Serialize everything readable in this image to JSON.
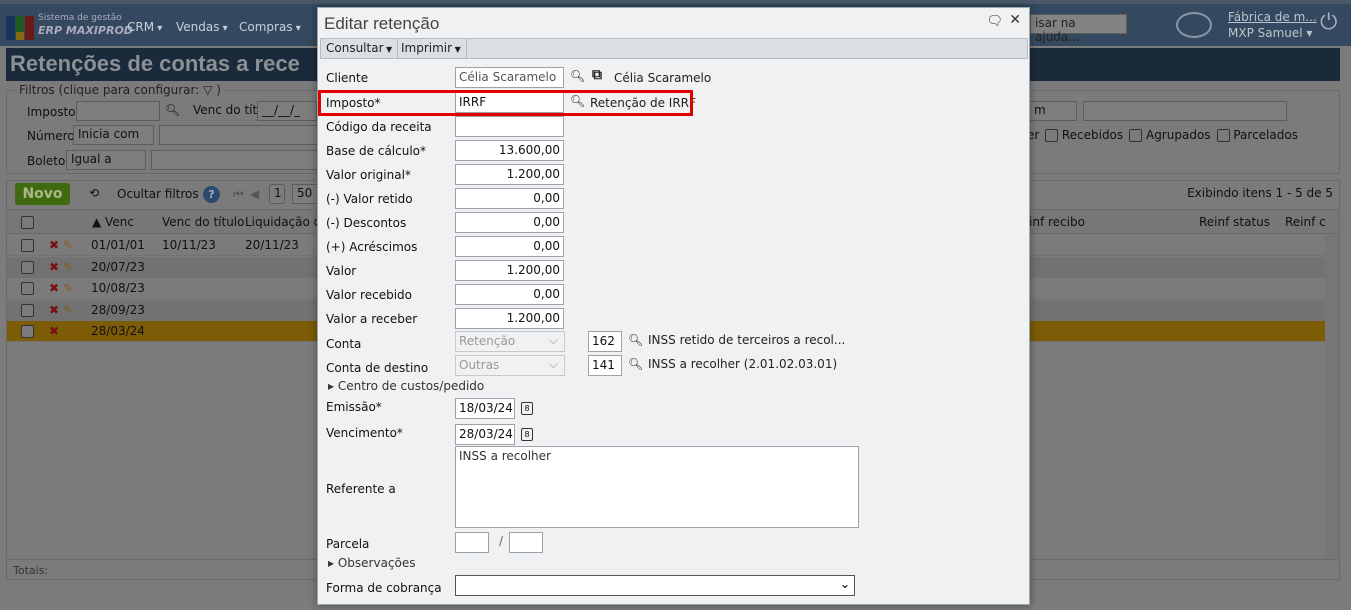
{
  "app": {
    "brand_line1": "Sistema de gestão",
    "brand_line2": "ERP MAXIPROD",
    "nav": [
      "CRM",
      "Vendas",
      "Compras"
    ],
    "help_search_placeholder": "isar na ajuda...",
    "company": "Fábrica de m...",
    "user": "MXP Samuel"
  },
  "page": {
    "title": "Retenções de contas a rece",
    "filters": {
      "legend": "Filtros (clique para configurar:",
      "imposto_label": "Imposto",
      "venc_titulo_label": "Venc do título",
      "venc_titulo_value": "__/__/_",
      "numero_label": "Número",
      "numero_op": "Inicia com",
      "boleto_label": "Boleto",
      "boleto_op": "Igual a",
      "right_op": "m",
      "checks": [
        "er",
        "Recebidos",
        "Agrupados",
        "Parcelados"
      ]
    },
    "toolbar": {
      "new": "Novo",
      "hide_filters": "Ocultar filtros",
      "page": "1",
      "page_size": "50",
      "showing": "Exibindo itens 1 - 5 de 5"
    },
    "columns": [
      "Venc",
      "Venc do título",
      "Liquidação d",
      "inf recibo",
      "Reinf status",
      "Reinf c"
    ],
    "rows": [
      {
        "venc": "01/01/01",
        "venc_titulo": "10/11/23",
        "liq": "20/11/23"
      },
      {
        "venc": "20/07/23"
      },
      {
        "venc": "10/08/23"
      },
      {
        "venc": "28/09/23"
      },
      {
        "venc": "28/03/24",
        "selected": true
      }
    ],
    "totals_label": "Totais:"
  },
  "dialog": {
    "title": "Editar retenção",
    "menu": [
      "Consultar",
      "Imprimir"
    ],
    "fields": {
      "cliente": {
        "label": "Cliente",
        "value": "Célia Scaramelo",
        "desc": "Célia Scaramelo"
      },
      "imposto": {
        "label": "Imposto*",
        "value": "IRRF",
        "desc": "Retenção de IRRF"
      },
      "codigo": {
        "label": "Código da receita",
        "value": ""
      },
      "base": {
        "label": "Base de cálculo*",
        "value": "13.600,00"
      },
      "valor_original": {
        "label": "Valor original*",
        "value": "1.200,00"
      },
      "valor_retido": {
        "label": "(-) Valor retido",
        "value": "0,00"
      },
      "descontos": {
        "label": "(-) Descontos",
        "value": "0,00"
      },
      "acrescimos": {
        "label": "(+) Acréscimos",
        "value": "0,00"
      },
      "valor": {
        "label": "Valor",
        "value": "1.200,00"
      },
      "valor_recebido": {
        "label": "Valor recebido",
        "value": "0,00"
      },
      "valor_receber": {
        "label": "Valor a receber",
        "value": "1.200,00"
      },
      "conta": {
        "label": "Conta",
        "select": "Retenção",
        "code": "162",
        "desc": "INSS retido de terceiros a recol..."
      },
      "conta_destino": {
        "label": "Conta de destino",
        "select": "Outras",
        "code": "141",
        "desc": "INSS a recolher (2.01.02.03.01)"
      },
      "centro": {
        "label": "Centro de custos/pedido"
      },
      "emissao": {
        "label": "Emissão*",
        "value": "18/03/24"
      },
      "vencimento": {
        "label": "Vencimento*",
        "value": "28/03/24"
      },
      "referente": {
        "label": "Referente a",
        "value": "INSS a recolher"
      },
      "parcela": {
        "label": "Parcela",
        "sep": "/",
        "value1": "",
        "value2": ""
      },
      "observacoes": {
        "label": "Observações"
      },
      "forma": {
        "label": "Forma de cobrança",
        "value": ""
      }
    },
    "highlight_color": "#e00000"
  }
}
